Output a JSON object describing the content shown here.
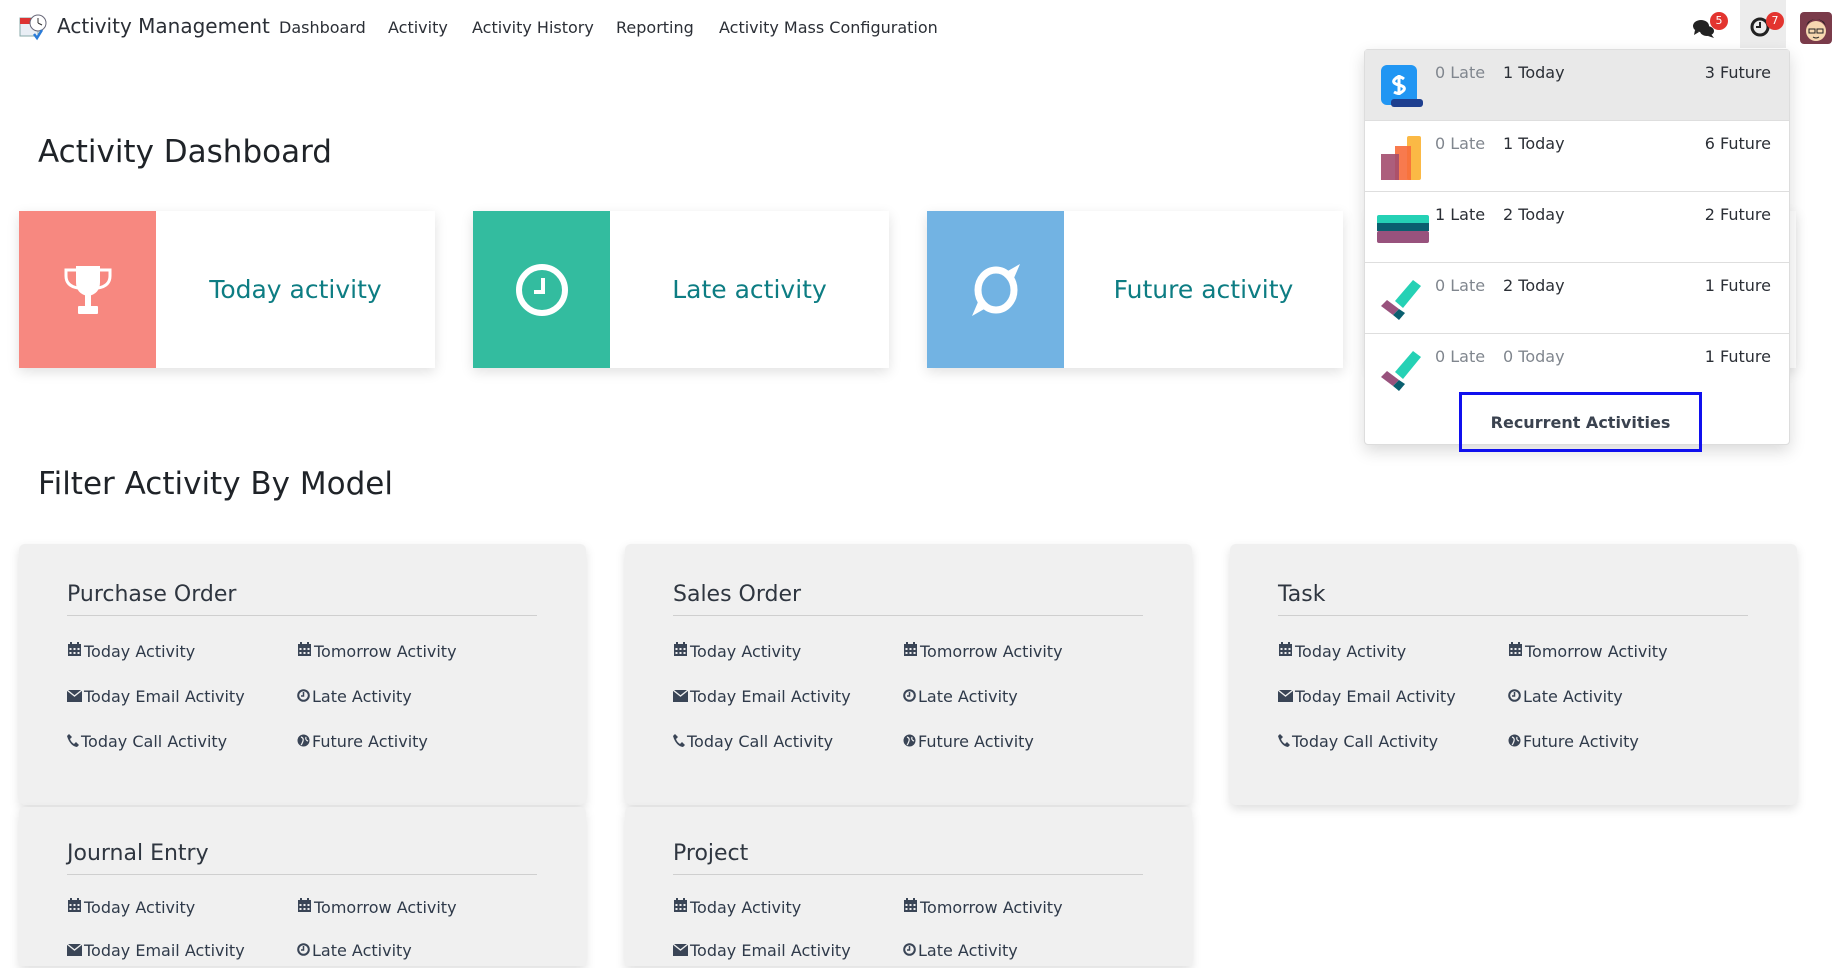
{
  "navbar": {
    "brand": "Activity Management",
    "menu": [
      "Dashboard",
      "Activity",
      "Activity History",
      "Reporting",
      "Activity Mass Configuration"
    ],
    "messages_badge": "5",
    "activities_badge": "7"
  },
  "dashboard": {
    "title": "Activity Dashboard",
    "cards": [
      {
        "label": "Today activity",
        "icon": "trophy-icon",
        "color": "#F78880"
      },
      {
        "label": "Late activity",
        "icon": "clock-icon",
        "color": "#33BC9F"
      },
      {
        "label": "Future activity",
        "icon": "orbit-icon",
        "color": "#72B3E3"
      }
    ]
  },
  "filter": {
    "title": "Filter Activity By Model",
    "links": [
      {
        "label": "Today Activity",
        "icon": "calendar-icon"
      },
      {
        "label": "Tomorrow Activity",
        "icon": "calendar-icon"
      },
      {
        "label": "Today Email Activity",
        "icon": "envelope-icon"
      },
      {
        "label": "Late Activity",
        "icon": "clock-icon"
      },
      {
        "label": "Today Call Activity",
        "icon": "phone-icon"
      },
      {
        "label": "Future Activity",
        "icon": "globe-icon"
      }
    ],
    "models": [
      "Purchase Order",
      "Sales Order",
      "Task",
      "Journal Entry",
      "Project"
    ]
  },
  "activity_dropdown": {
    "rows": [
      {
        "app": "invoicing",
        "late": "0 Late",
        "today": "1 Today",
        "future": "3 Future"
      },
      {
        "app": "sales",
        "late": "0 Late",
        "today": "1 Today",
        "future": "6 Future"
      },
      {
        "app": "purchase",
        "late": "1 Late",
        "today": "2 Today",
        "future": "2 Future"
      },
      {
        "app": "project",
        "late": "0 Late",
        "today": "2 Today",
        "future": "1 Future"
      },
      {
        "app": "project",
        "late": "0 Late",
        "today": "0 Today",
        "future": "1 Future"
      }
    ],
    "recurrent_label": "Recurrent Activities"
  }
}
